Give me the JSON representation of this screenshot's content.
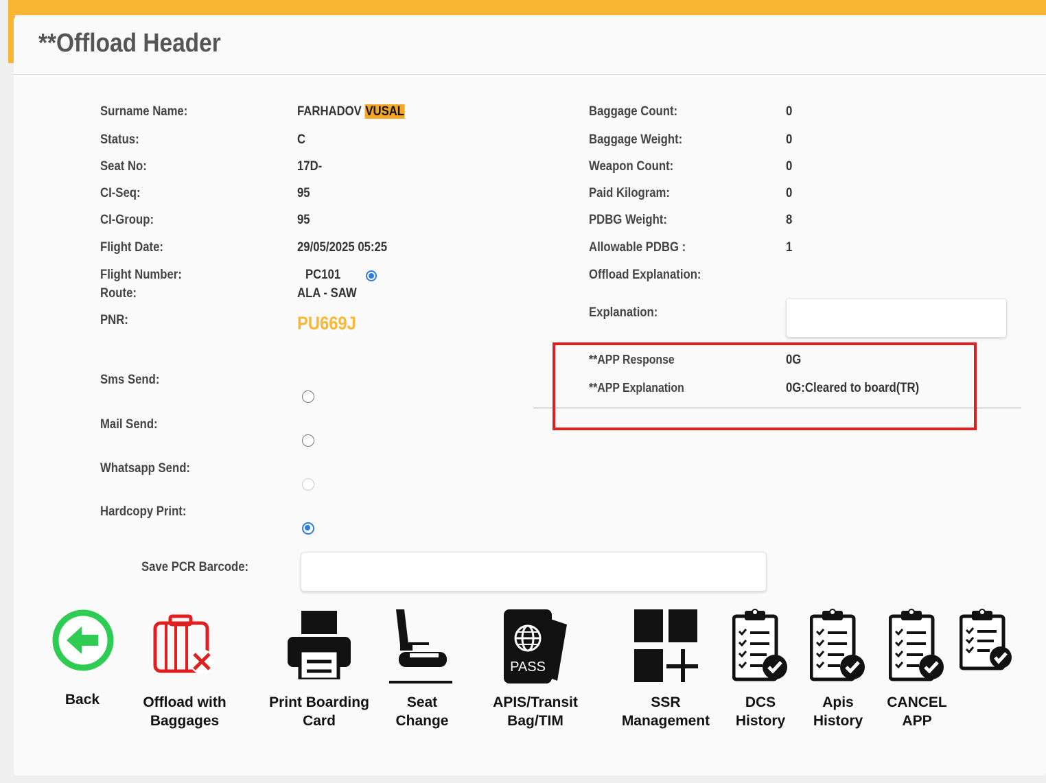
{
  "page": {
    "title": "**Offload Header"
  },
  "passenger": {
    "surname_label": "Surname Name:",
    "surname": "FARHADOV",
    "given_name": "VUSAL",
    "status_label": "Status:",
    "status": "C",
    "seat_label": "Seat No:",
    "seat": "17D-",
    "ciseq_label": "CI-Seq:",
    "ciseq": "95",
    "cigroup_label": "CI-Group:",
    "cigroup": "95",
    "flight_date_label": "Flight Date:",
    "flight_date": "29/05/2025 05:25",
    "flight_number_label": "Flight Number:",
    "flight_number": "PC101",
    "route_label": "Route:",
    "route": "ALA - SAW",
    "pnr_label": "PNR:",
    "pnr": "PU669J"
  },
  "baggage": {
    "count_label": "Baggage Count:",
    "count": "0",
    "weight_label": "Baggage Weight:",
    "weight": "0",
    "weapon_label": "Weapon Count:",
    "weapon": "0",
    "paid_label": "Paid Kilogram:",
    "paid": "0",
    "pdbg_label": "PDBG Weight:",
    "pdbg": "8",
    "allowable_label": "Allowable PDBG :",
    "allowable": "1",
    "offload_expl_label": "Offload Explanation:",
    "explanation_label": "Explanation:",
    "explanation_value": ""
  },
  "app": {
    "response_label": "**APP Response",
    "response": "0G",
    "explanation_label": "**APP Explanation",
    "explanation": "0G:Cleared to board(TR)"
  },
  "notifications": {
    "sms_label": "Sms Send:",
    "sms_checked": false,
    "mail_label": "Mail Send:",
    "mail_checked": false,
    "whatsapp_label": "Whatsapp Send:",
    "whatsapp_checked": false,
    "whatsapp_disabled": true,
    "hardcopy_label": "Hardcopy Print:",
    "hardcopy_checked": true
  },
  "barcode": {
    "label": "Save PCR Barcode:",
    "value": ""
  },
  "actions": [
    {
      "label": "Back",
      "icon": "arrow-left-circle-icon"
    },
    {
      "label": "Offload with\nBaggages",
      "icon": "luggage-remove-icon"
    },
    {
      "label": "Print Boarding\nCard",
      "icon": "printer-icon"
    },
    {
      "label": "Seat\nChange",
      "icon": "seat-icon"
    },
    {
      "label": "APIS/Transit\nBag/TIM",
      "icon": "passport-icon"
    },
    {
      "label": "SSR\nManagement",
      "icon": "grid-plus-icon"
    },
    {
      "label": "DCS\nHistory",
      "icon": "clipboard-check-icon"
    },
    {
      "label": "Apis\nHistory",
      "icon": "clipboard-check-icon"
    },
    {
      "label": "CANCEL\nAPP",
      "icon": "clipboard-check-icon"
    },
    {
      "label": "",
      "icon": "clipboard-check-icon"
    }
  ],
  "colors": {
    "accent": "#f7b733",
    "highlight": "#f5a623",
    "radio": "#2d7be5",
    "annotation": "#e02020",
    "back_green": "#2ecc52",
    "luggage_red": "#e02020"
  },
  "icons": {
    "passport_text": "PASS"
  }
}
